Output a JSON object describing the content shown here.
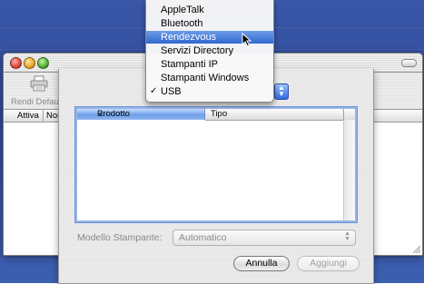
{
  "toolbar": {
    "default_label": "Rendi Default"
  },
  "list_header": {
    "col1": "Attiva",
    "col2": "Nome"
  },
  "menu": {
    "items": [
      "AppleTalk",
      "Bluetooth",
      "Rendezvous",
      "Servizi Directory",
      "Stampanti IP",
      "Stampanti Windows",
      "USB"
    ],
    "selected": "Rendezvous",
    "checked": "USB",
    "check_glyph": "✓"
  },
  "sheet": {
    "columns": {
      "product": "Prodotto",
      "type": "Tipo"
    },
    "model_label": "Modello Stampante:",
    "model_value": "Automatico",
    "cancel_button": "Annulla",
    "add_button": "Aggiungi"
  },
  "colors": {
    "desktop": "#3a56a6",
    "selection": "#2f68d0"
  }
}
